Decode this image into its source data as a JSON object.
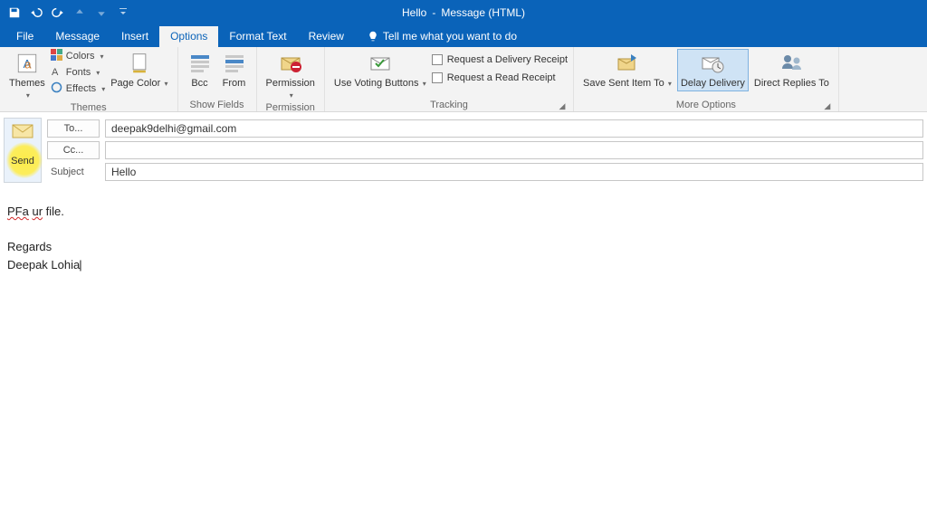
{
  "window_title_prefix": "Hello",
  "window_title_sep": "-",
  "window_title_suffix": "Message (HTML)",
  "ribbon_tabs": {
    "file": "File",
    "message": "Message",
    "insert": "Insert",
    "options": "Options",
    "format_text": "Format Text",
    "review": "Review",
    "tell_me": "Tell me what you want to do"
  },
  "themes_group": {
    "themes": "Themes",
    "colors": "Colors",
    "fonts": "Fonts",
    "effects": "Effects",
    "page_color": "Page Color",
    "label": "Themes"
  },
  "show_fields_group": {
    "bcc": "Bcc",
    "from": "From",
    "label": "Show Fields"
  },
  "permission_group": {
    "permission": "Permission",
    "label": "Permission"
  },
  "tracking_group": {
    "voting": "Use Voting Buttons",
    "delivery": "Request a Delivery Receipt",
    "read": "Request a Read Receipt",
    "label": "Tracking"
  },
  "more_options_group": {
    "save_sent": "Save Sent Item To",
    "delay": "Delay Delivery",
    "direct": "Direct Replies To",
    "label": "More Options"
  },
  "compose": {
    "send": "Send",
    "to_btn": "To...",
    "cc_btn": "Cc...",
    "subject_label": "Subject",
    "to_value": "deepak9delhi@gmail.com",
    "cc_value": "",
    "subject_value": "Hello"
  },
  "body": {
    "line1_a": "PFa",
    "line1_b": "ur",
    "line1_c": " file.",
    "line2": "Regards",
    "line3": "Deepak Lohia"
  }
}
